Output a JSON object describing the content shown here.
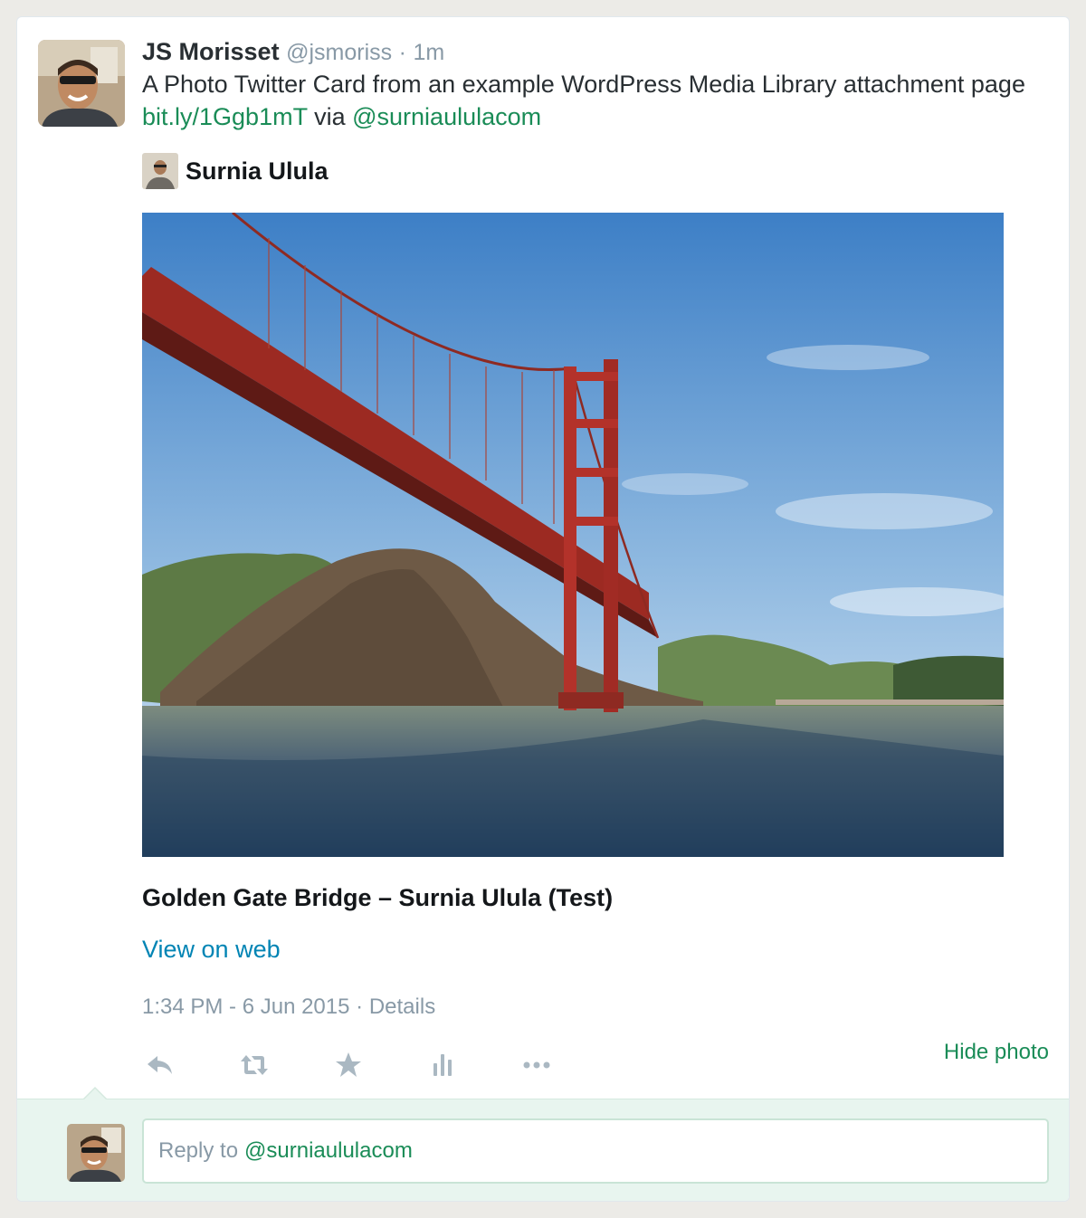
{
  "tweet": {
    "author_name": "JS Morisset",
    "author_handle": "@jsmoriss",
    "separator": "·",
    "time_ago": "1m",
    "text_before": "A Photo Twitter Card from an example WordPress Media Library attachment page ",
    "link_text": "bit.ly/1Ggb1mT",
    "text_via": " via ",
    "mention_text": "@surniaululacom"
  },
  "card": {
    "site_name": "Surnia Ulula",
    "photo_title": "Golden Gate Bridge – Surnia Ulula (Test)",
    "view_on_web": "View on web"
  },
  "meta": {
    "timestamp": "1:34 PM - 6 Jun 2015",
    "separator": "·",
    "details": "Details"
  },
  "actions": {
    "icons": [
      "reply-icon",
      "retweet-icon",
      "favorite-icon",
      "analytics-icon",
      "more-icon"
    ],
    "hide_photo": "Hide photo"
  },
  "reply": {
    "prefix": "Reply to",
    "mention": "@surniaululacom"
  },
  "colors": {
    "link_green": "#1a8c57",
    "link_blue": "#0084b4",
    "muted": "#8899a6",
    "reply_bg": "#e8f5ef"
  }
}
